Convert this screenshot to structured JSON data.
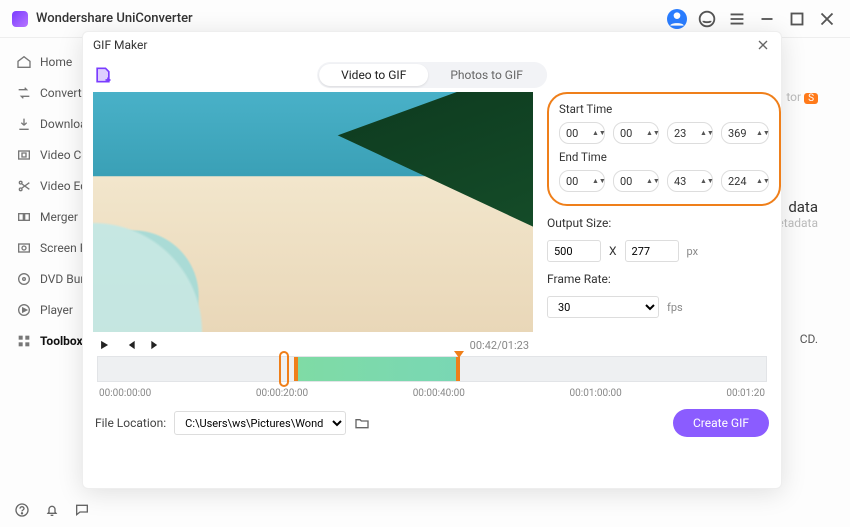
{
  "app": {
    "title": "Wondershare UniConverter"
  },
  "sidebar": {
    "items": [
      {
        "label": "Home"
      },
      {
        "label": "Converter"
      },
      {
        "label": "Downloader"
      },
      {
        "label": "Video Compressor"
      },
      {
        "label": "Video Editor"
      },
      {
        "label": "Merger"
      },
      {
        "label": "Screen Recorder"
      },
      {
        "label": "DVD Burner"
      },
      {
        "label": "Player"
      },
      {
        "label": "Toolbox"
      }
    ]
  },
  "bg": {
    "tor_badge": "tor",
    "s_badge": "S",
    "data": "data",
    "etadata": "etadata",
    "cd": "CD."
  },
  "modal": {
    "title": "GIF Maker",
    "tabs": {
      "video": "Video to GIF",
      "photos": "Photos to GIF"
    },
    "time_current": "00:42/01:23",
    "start_label": "Start Time",
    "end_label": "End Time",
    "start": {
      "h": "00",
      "m": "00",
      "s": "23",
      "ms": "369"
    },
    "end": {
      "h": "00",
      "m": "00",
      "s": "43",
      "ms": "224"
    },
    "output_label": "Output Size:",
    "output_w": "500",
    "output_x": "X",
    "output_h": "277",
    "output_unit": "px",
    "fps_label": "Frame Rate:",
    "fps_value": "30",
    "fps_unit": "fps",
    "ruler": [
      "00:00:00:00",
      "00:00:20:00",
      "00:00:40:00",
      "00:01:00:00",
      "00:01:20"
    ],
    "file_loc_label": "File Location:",
    "file_loc_value": "C:\\Users\\ws\\Pictures\\Wonders",
    "create_btn": "Create GIF"
  }
}
